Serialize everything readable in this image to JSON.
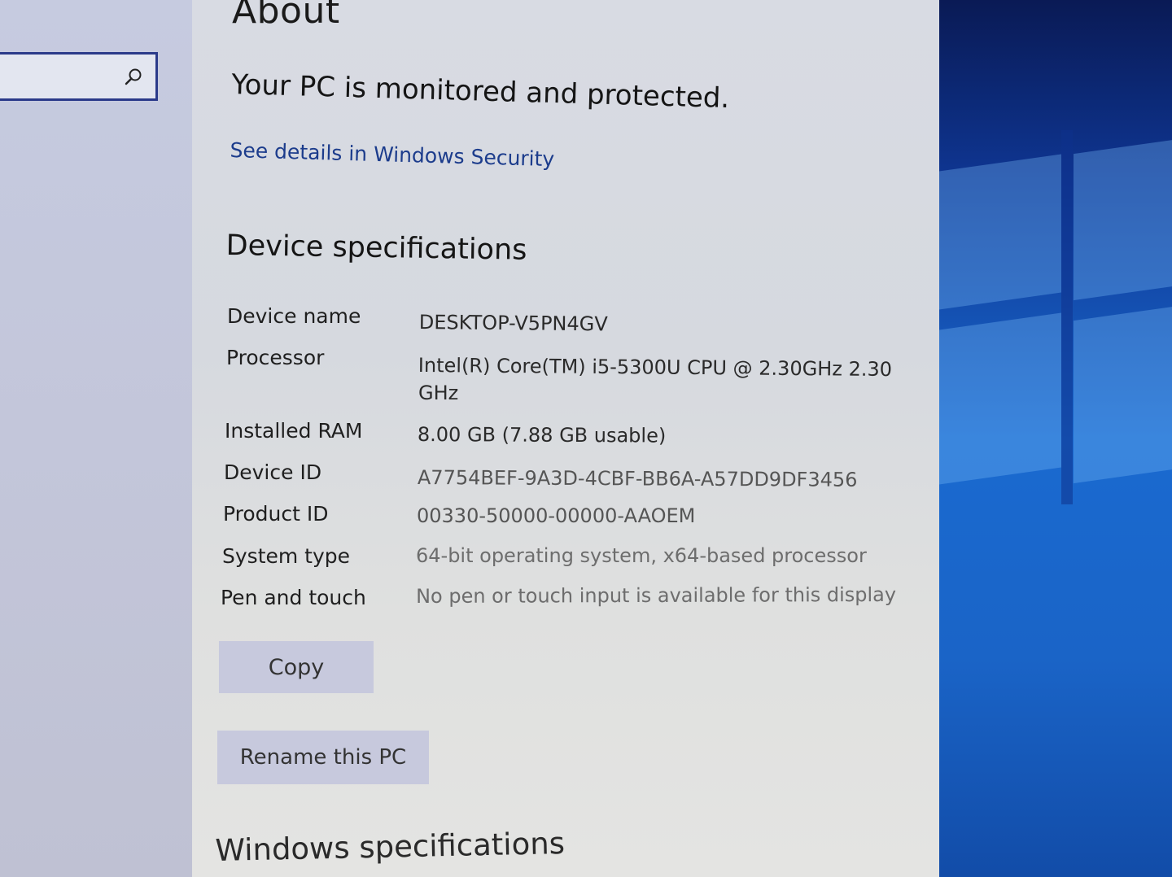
{
  "search": {
    "icon": "search-icon",
    "value": ""
  },
  "page": {
    "title": "About",
    "security_status": "Your PC is monitored and protected.",
    "security_link": "See details in Windows Security"
  },
  "device_specs": {
    "title": "Device specifications",
    "rows": [
      {
        "label": "Device name",
        "value": "DESKTOP-V5PN4GV"
      },
      {
        "label": "Processor",
        "value": "Intel(R) Core(TM) i5-5300U CPU @ 2.30GHz   2.30",
        "value_line2": "GHz"
      },
      {
        "label": "Installed RAM",
        "value": "8.00 GB (7.88 GB usable)"
      },
      {
        "label": "Device ID",
        "value": "A7754BEF-9A3D-4CBF-BB6A-A57DD9DF3456"
      },
      {
        "label": "Product ID",
        "value": "00330-50000-00000-AAOEM"
      },
      {
        "label": "System type",
        "value": "64-bit operating system, x64-based processor"
      },
      {
        "label": "Pen and touch",
        "value": "No pen or touch input is available for this display"
      }
    ],
    "copy_label": "Copy",
    "rename_label": "Rename this PC"
  },
  "windows_specs": {
    "title": "Windows specifications"
  },
  "colors": {
    "link": "#1c3c8c",
    "button_bg": "#c7c9dd",
    "search_border": "#2b3a8a",
    "desktop_blue": "#1a6ad0"
  }
}
